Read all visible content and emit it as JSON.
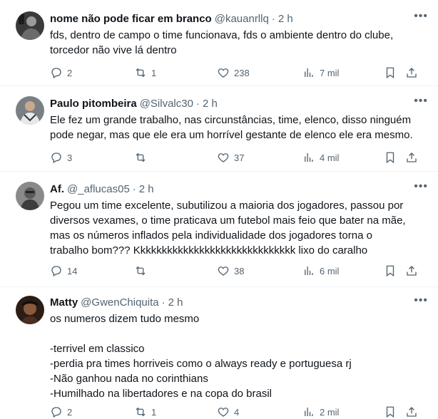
{
  "more_icon": "more-horizontal-icon",
  "tweets": [
    {
      "name": "nome não pode ficar em branco",
      "handle": "@kauanrllq",
      "time": "2 h",
      "text": "fds, dentro de campo o time funcionava, fds o ambiente dentro do clube,\ntorcedor não vive lá dentro",
      "replies": "2",
      "retweets": "1",
      "likes": "238",
      "views": "7 mil"
    },
    {
      "name": "Paulo pitombeira",
      "handle": "@Silvalc30",
      "time": "2 h",
      "text": "Ele fez um grande trabalho, nas circunstâncias, time, elenco, disso ninguém\npode negar, mas que ele era um horrível gestante de elenco ele era mesmo.",
      "replies": "3",
      "retweets": "",
      "likes": "37",
      "views": "4 mil"
    },
    {
      "name": "Af.",
      "handle": "@_aflucas05",
      "time": "2 h",
      "text": "Pegou um time excelente, subutilizou a maioria dos jogadores, passou por\ndiversos vexames, o time praticava um futebol mais feio que bater na mãe,\nmas os números inflados pela individualidade dos jogadores torna o\ntrabalho bom??? Kkkkkkkkkkkkkkkkkkkkkkkkkkkkkk lixo do caralho",
      "replies": "14",
      "retweets": "",
      "likes": "38",
      "views": "6 mil"
    },
    {
      "name": "Matty",
      "handle": "@GwenChiquita",
      "time": "2 h",
      "text": "os numeros dizem tudo mesmo\n\n-terrivel em classico\n-perdia pra times horriveis como o always ready e portuguesa rj\n-Não ganhou nada no corinthians\n-Humilhado na libertadores e na copa do brasil",
      "replies": "2",
      "retweets": "1",
      "likes": "4",
      "views": "2 mil"
    }
  ],
  "colors": {
    "text": "#0f1419",
    "secondary": "#536471",
    "divider": "#eff3f4"
  }
}
